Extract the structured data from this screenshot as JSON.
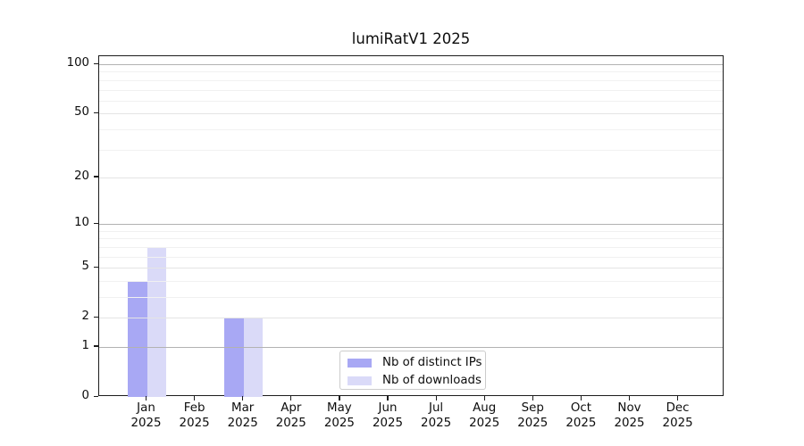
{
  "title": "lumiRatV1 2025",
  "chart_data": {
    "type": "bar",
    "title": "lumiRatV1 2025",
    "categories": [
      "Jan 2025",
      "Feb 2025",
      "Mar 2025",
      "Apr 2025",
      "May 2025",
      "Jun 2025",
      "Jul 2025",
      "Aug 2025",
      "Sep 2025",
      "Oct 2025",
      "Nov 2025",
      "Dec 2025"
    ],
    "series": [
      {
        "name": "Nb of distinct IPs",
        "color": "#a8a8f4",
        "values": [
          4,
          0,
          2,
          0,
          0,
          0,
          0,
          0,
          0,
          0,
          0,
          0
        ]
      },
      {
        "name": "Nb of downloads",
        "color": "#dadaf8",
        "values": [
          7,
          0,
          2,
          0,
          0,
          0,
          0,
          0,
          0,
          0,
          0,
          0
        ]
      }
    ],
    "yscale": "log1p",
    "ylim": [
      0,
      112
    ],
    "y_major_ticks": [
      0,
      1,
      2,
      5,
      10,
      20,
      50,
      100
    ],
    "y_minor_ticks": [
      3,
      4,
      6,
      7,
      8,
      9,
      30,
      40,
      60,
      70,
      80,
      90
    ],
    "grid": "horizontal",
    "legend_position": "lower-center",
    "xlabel": "",
    "ylabel": ""
  }
}
